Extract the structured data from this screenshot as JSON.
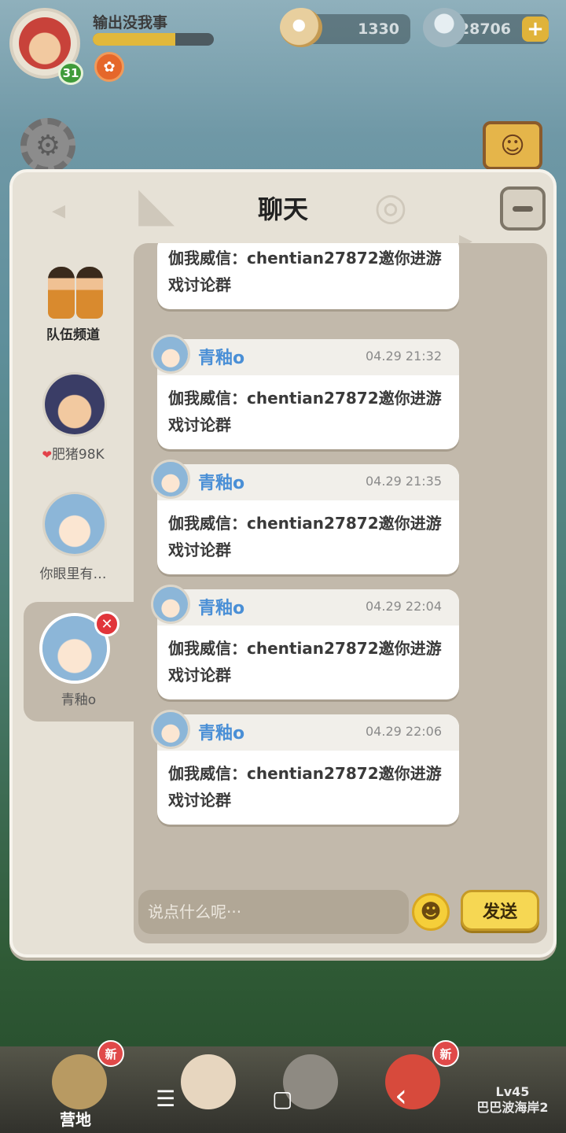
{
  "hud": {
    "player_name": "输出没我事",
    "level": "31",
    "exp_fraction": 0.68,
    "pearls": "1330",
    "shells": "28706",
    "plus": "+"
  },
  "panel": {
    "title": "聊天",
    "close_glyph": ""
  },
  "sidebar": {
    "items": [
      {
        "label": "队伍频道"
      },
      {
        "label": "肥猪98K",
        "heart": "❤"
      },
      {
        "label": "你眼里有…"
      },
      {
        "label": "青釉o",
        "remove": "✕"
      }
    ]
  },
  "messages": [
    {
      "name": "",
      "time": "",
      "text": "伽我威信：chentian27872邀你进游戏讨论群"
    },
    {
      "name": "青釉o",
      "time": "04.29 21:32",
      "text": "伽我威信：chentian27872邀你进游戏讨论群"
    },
    {
      "name": "青釉o",
      "time": "04.29 21:35",
      "text": "伽我威信：chentian27872邀你进游戏讨论群"
    },
    {
      "name": "青釉o",
      "time": "04.29 22:04",
      "text": "伽我威信：chentian27872邀你进游戏讨论群"
    },
    {
      "name": "青釉o",
      "time": "04.29 22:06",
      "text": "伽我威信：chentian27872邀你进游戏讨论群"
    }
  ],
  "input": {
    "placeholder": "说点什么呢···",
    "emoji": "☻",
    "send_label": "发送"
  },
  "bottom_nav": {
    "camp_label": "营地",
    "new_badge": "新",
    "locked_level": "Lv45",
    "locked_name": "巴巴波海岸2"
  },
  "system_nav": {
    "menu": "☰",
    "home": "▢",
    "back": "‹"
  },
  "colors": {
    "name_blue": "#4a8fd6",
    "send_yellow": "#f6d753",
    "remove_red": "#e1353b"
  }
}
